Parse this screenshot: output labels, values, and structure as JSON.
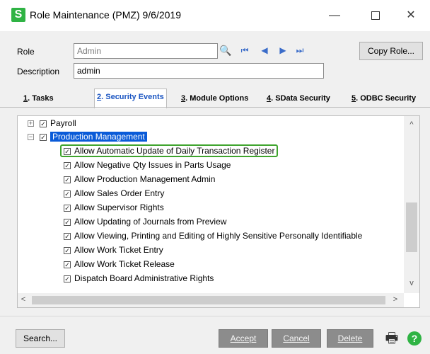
{
  "window": {
    "app_icon": "S",
    "title": "Role Maintenance (PMZ) 9/6/2019",
    "minimize": "—",
    "close": "✕"
  },
  "form": {
    "role_label": "Role",
    "role_value": "Admin",
    "description_label": "Description",
    "description_value": "admin",
    "copy_role_label": "Copy Role..."
  },
  "tabs": [
    {
      "key": "1",
      "label": ". Tasks"
    },
    {
      "key": "2",
      "label": ". Security Events"
    },
    {
      "key": "3",
      "label": ". Module Options"
    },
    {
      "key": "4",
      "label": ". SData Security"
    },
    {
      "key": "5",
      "label": ". ODBC Security"
    }
  ],
  "tree": {
    "payroll": "Payroll",
    "production_management": "Production Management",
    "items": [
      "Allow Automatic Update of Daily Transaction Register",
      "Allow Negative Qty Issues in Parts Usage",
      "Allow Production Management Admin",
      "Allow Sales Order Entry",
      "Allow Supervisor Rights",
      "Allow Updating of Journals from Preview",
      "Allow Viewing, Printing and Editing of Highly Sensitive Personally Identifiable",
      "Allow Work Ticket Entry",
      "Allow Work Ticket Release",
      "Dispatch Board Administrative Rights"
    ]
  },
  "footer": {
    "search": "Search...",
    "accept": "Accept",
    "cancel": "Cancel",
    "delete": "Delete"
  },
  "icons": {
    "expand": "+",
    "collapse": "−",
    "check": "✓",
    "lookup": "🔍",
    "first": "⏮",
    "prev": "◀",
    "next": "▶",
    "last": "⏭",
    "print": "🖶",
    "help": "?",
    "scroll_up": "^",
    "scroll_down": "v",
    "scroll_left": "<",
    "scroll_right": ">"
  },
  "colors": {
    "selection": "#0a5bd8",
    "focus_outline": "#3fa42e",
    "brand": "#2fb344"
  }
}
